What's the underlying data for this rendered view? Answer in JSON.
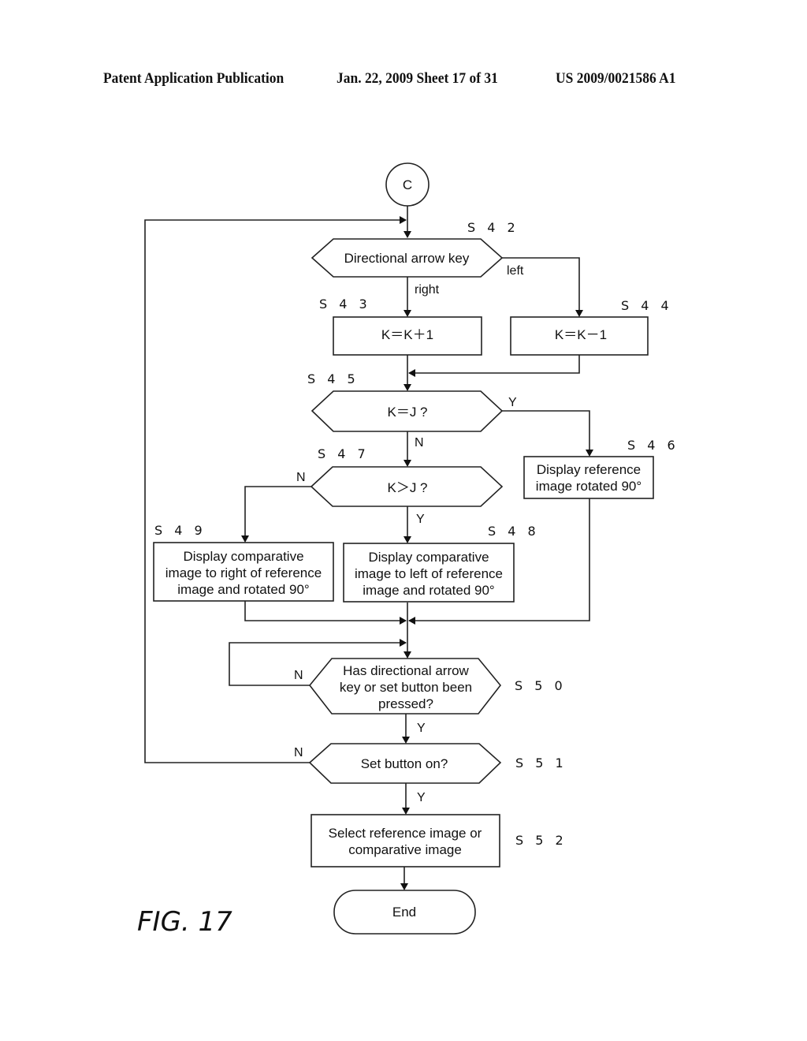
{
  "header": {
    "publication": "Patent Application Publication",
    "date_sheet": "Jan. 22, 2009  Sheet 17 of 31",
    "patent_number": "US 2009/0021586 A1"
  },
  "figure_label": "FIG. 17",
  "connector": {
    "label": "C"
  },
  "steps": {
    "s42": {
      "id": "S42",
      "label": "S 4 2",
      "text": "Directional arrow key"
    },
    "s43": {
      "id": "S43",
      "label": "S 4 3",
      "text": "K＝K＋1"
    },
    "s44": {
      "id": "S44",
      "label": "S 4 4",
      "text": "K＝K－1"
    },
    "s45": {
      "id": "S45",
      "label": "S 4 5",
      "text": "K＝J ?"
    },
    "s46": {
      "id": "S46",
      "label": "S 4 6",
      "lines": [
        "Display reference",
        "image rotated 90°"
      ]
    },
    "s47": {
      "id": "S47",
      "label": "S 4 7",
      "text": "K＞J ?"
    },
    "s48": {
      "id": "S48",
      "label": "S 4 8",
      "lines": [
        "Display comparative",
        "image to left of reference",
        "image and rotated 90°"
      ]
    },
    "s49": {
      "id": "S49",
      "label": "S 4 9",
      "lines": [
        "Display comparative",
        "image to right of reference",
        "image and rotated 90°"
      ]
    },
    "s50": {
      "id": "S50",
      "label": "S 5 0",
      "lines": [
        "Has directional arrow",
        "key or set button been",
        "pressed?"
      ]
    },
    "s51": {
      "id": "S51",
      "label": "S 5 1",
      "text": "Set button on?"
    },
    "s52": {
      "id": "S52",
      "label": "S 5 2",
      "lines": [
        "Select reference image or",
        "comparative image"
      ]
    },
    "end": {
      "text": "End"
    }
  },
  "branch_labels": {
    "s42_right": "right",
    "s42_left": "left",
    "s45_yes": "Y",
    "s45_no": "N",
    "s47_yes": "Y",
    "s47_no": "N",
    "s50_yes": "Y",
    "s50_no": "N",
    "s51_yes": "Y",
    "s51_no": "N"
  }
}
